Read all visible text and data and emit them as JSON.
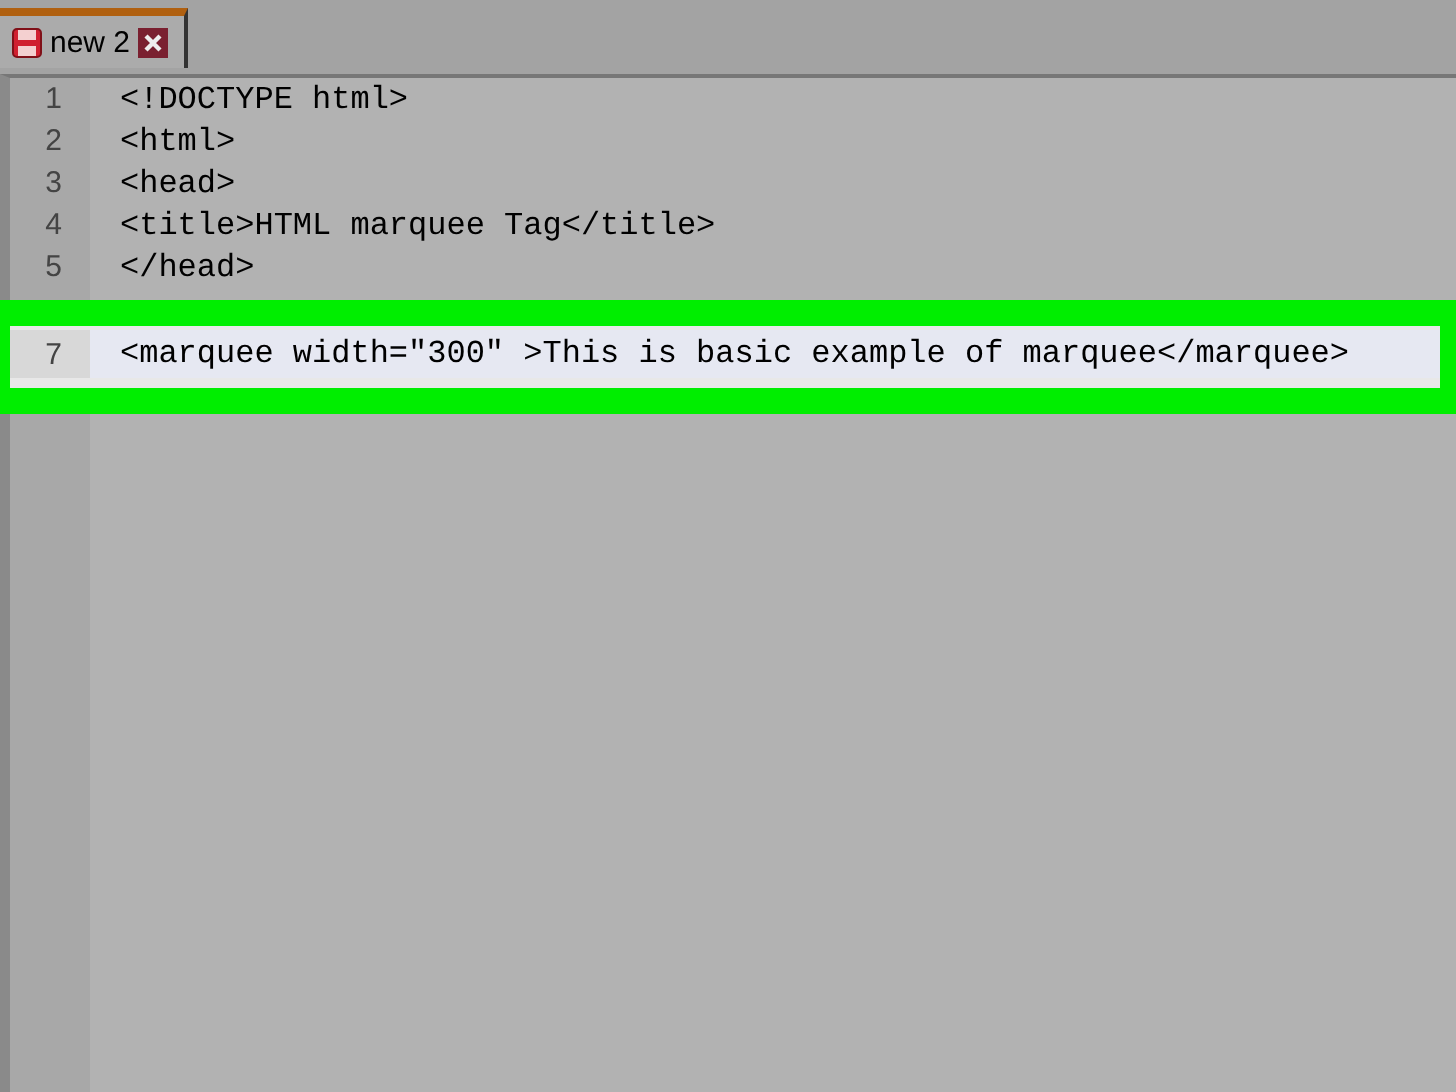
{
  "tab": {
    "label": "new 2",
    "selected": true
  },
  "lines": [
    {
      "number": "1",
      "text": "<!DOCTYPE html>",
      "current": false,
      "highlighted": false
    },
    {
      "number": "2",
      "text": "<html>",
      "current": false,
      "highlighted": false
    },
    {
      "number": "3",
      "text": "<head>",
      "current": false,
      "highlighted": false
    },
    {
      "number": "4",
      "text": "<title>HTML marquee Tag</title>",
      "current": false,
      "highlighted": false
    },
    {
      "number": "5",
      "text": "</head>",
      "current": false,
      "highlighted": false
    },
    {
      "number": "7",
      "text": "<marquee width=\"300\" >This is basic example of marquee</marquee>",
      "current": true,
      "highlighted": true
    }
  ]
}
